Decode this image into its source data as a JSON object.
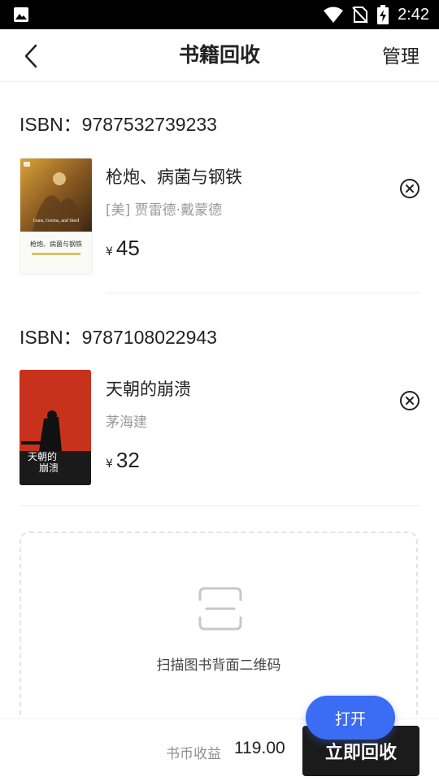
{
  "status_bar": {
    "time": "2:42",
    "icons": [
      "image-icon",
      "wifi-icon",
      "no-sim-icon",
      "battery-charging-icon"
    ]
  },
  "nav": {
    "back_icon": "back-arrow-icon",
    "title": "书籍回收",
    "manage_label": "管理"
  },
  "books": [
    {
      "isbn_label": "ISBN：9787532739233",
      "title": "枪炮、病菌与钢铁",
      "author": "[美] 贾雷德·戴蒙德",
      "currency": "¥",
      "price": "45",
      "cover_title": "枪炮、病菌与钢铁",
      "cover_en": "Guns, Germs, and Steel"
    },
    {
      "isbn_label": "ISBN：9787108022943",
      "title": "天朝的崩溃",
      "author": "茅海建",
      "currency": "¥",
      "price": "32",
      "cover_title_line1": "天朝的",
      "cover_title_line2": "崩溃"
    }
  ],
  "scan": {
    "icon": "scan-icon",
    "text": "扫描图书背面二维码"
  },
  "bottom": {
    "earnings_label": "书币收益",
    "earnings_value": "119.00",
    "recycle_label": "立即回收"
  },
  "floating": {
    "open_label": "打开"
  },
  "colors": {
    "accent_blue": "#3b6cf4",
    "recycle_button": "#1b1b1b",
    "muted_text": "#9a9a9a"
  }
}
